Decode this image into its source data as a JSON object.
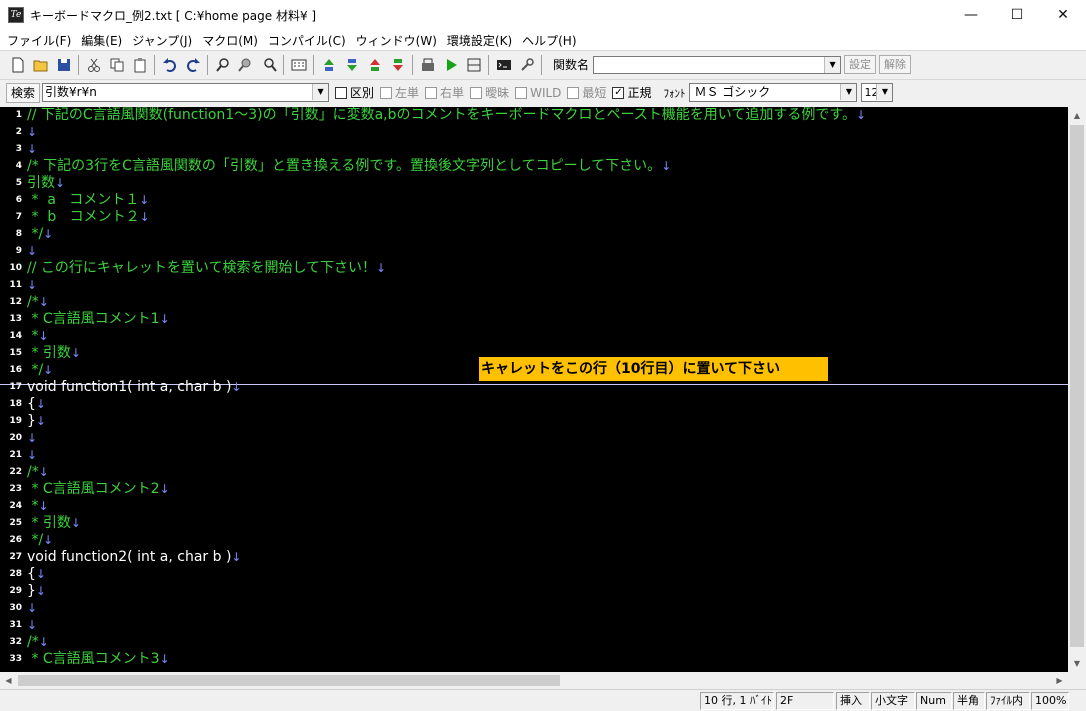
{
  "window": {
    "title": "キーボードマクロ_例2.txt [ C:¥home page 材料¥ ]",
    "minimize": "—",
    "maximize": "☐",
    "close": "✕"
  },
  "menu": [
    "ファイル(F)",
    "編集(E)",
    "ジャンプ(J)",
    "マクロ(M)",
    "コンパイル(C)",
    "ウィンドウ(W)",
    "環境設定(K)",
    "ヘルプ(H)"
  ],
  "toolbar": {
    "function_name_label": "関数名",
    "function_name_value": "",
    "set_button": "設定",
    "clear_button": "解除",
    "buttons": [
      "new-file-icon",
      "open-folder-icon",
      "save-icon",
      "cut-icon",
      "copy-icon",
      "paste-icon",
      "undo-icon",
      "redo-icon",
      "search-icon",
      "search-prev-icon",
      "search-next-icon",
      "macro-icon",
      "jump-up-icon",
      "jump-down-icon",
      "mark-up-icon",
      "mark-down-icon",
      "compile-icon",
      "run-icon",
      "split-icon",
      "console-icon",
      "tool-icon"
    ]
  },
  "searchbar": {
    "label": "検索",
    "query": "引数¥r¥n",
    "options": [
      {
        "label": "区別",
        "checked": false,
        "enabled": true
      },
      {
        "label": "左単",
        "checked": false,
        "enabled": false
      },
      {
        "label": "右単",
        "checked": false,
        "enabled": false
      },
      {
        "label": "曖昧",
        "checked": false,
        "enabled": false
      },
      {
        "label": "WILD",
        "checked": false,
        "enabled": false
      },
      {
        "label": "最短",
        "checked": false,
        "enabled": false
      },
      {
        "label": "正規",
        "checked": true,
        "enabled": true
      }
    ],
    "font_label": "ﾌｫﾝﾄ",
    "font_value": "ＭＳ ゴシック",
    "size_value": "12"
  },
  "editor": {
    "lines": [
      {
        "n": "1",
        "text": "// 下記のC言語風関数(function1～3)の「引数」に変数a,bのコメントをキーボードマクロとペースト機能を用いて追加する例です。",
        "type": "comment"
      },
      {
        "n": "2",
        "text": "",
        "type": "code"
      },
      {
        "n": "3",
        "text": "",
        "type": "code"
      },
      {
        "n": "4",
        "text": "/* 下記の3行をC言語風関数の「引数」と置き換える例です。置換後文字列としてコピーして下さい。",
        "type": "comment"
      },
      {
        "n": "5",
        "text": "引数",
        "type": "comment"
      },
      {
        "n": "6",
        "text": " *  a   コメント１",
        "type": "comment"
      },
      {
        "n": "7",
        "text": " *  b   コメント２",
        "type": "comment"
      },
      {
        "n": "8",
        "text": " */",
        "type": "comment"
      },
      {
        "n": "9",
        "text": "",
        "type": "code"
      },
      {
        "n": "10",
        "text": "// この行にキャレットを置いて検索を開始して下さい！",
        "type": "comment"
      },
      {
        "n": "11",
        "text": "",
        "type": "code"
      },
      {
        "n": "12",
        "text": "/*",
        "type": "comment"
      },
      {
        "n": "13",
        "text": " * C言語風コメント1",
        "type": "comment"
      },
      {
        "n": "14",
        "text": " *",
        "type": "comment"
      },
      {
        "n": "15",
        "text": " * 引数",
        "type": "comment"
      },
      {
        "n": "16",
        "text": " */",
        "type": "comment"
      },
      {
        "n": "17",
        "text": "void function1( int a, char b )",
        "type": "code"
      },
      {
        "n": "18",
        "text": "{",
        "type": "code"
      },
      {
        "n": "19",
        "text": "}",
        "type": "code"
      },
      {
        "n": "20",
        "text": "",
        "type": "code"
      },
      {
        "n": "21",
        "text": "",
        "type": "code"
      },
      {
        "n": "22",
        "text": "/*",
        "type": "comment"
      },
      {
        "n": "23",
        "text": " * C言語風コメント2",
        "type": "comment"
      },
      {
        "n": "24",
        "text": " *",
        "type": "comment"
      },
      {
        "n": "25",
        "text": " * 引数",
        "type": "comment"
      },
      {
        "n": "26",
        "text": " */",
        "type": "comment"
      },
      {
        "n": "27",
        "text": "void function2( int a, char b )",
        "type": "code"
      },
      {
        "n": "28",
        "text": "{",
        "type": "code"
      },
      {
        "n": "29",
        "text": "}",
        "type": "code"
      },
      {
        "n": "30",
        "text": "",
        "type": "code"
      },
      {
        "n": "31",
        "text": "",
        "type": "code"
      },
      {
        "n": "32",
        "text": "/*",
        "type": "comment"
      },
      {
        "n": "33",
        "text": " * C言語風コメント3",
        "type": "comment"
      }
    ],
    "newline_mark": "↓",
    "annotation": "キャレットをこの行（10行目）に置いて下さい"
  },
  "status": {
    "position": "10 行, 1 ﾊﾞｲﾄ",
    "code": "2F",
    "insert": "挿入",
    "case": "小文字",
    "num": "Num",
    "width": "半角",
    "scope": "ﾌｧｲﾙ内",
    "zoom": "100%"
  },
  "colors": {
    "comment": "#3cd23c",
    "code": "#ffffff",
    "newline": "#7b8cff",
    "annotation_bg": "#ffc000"
  }
}
